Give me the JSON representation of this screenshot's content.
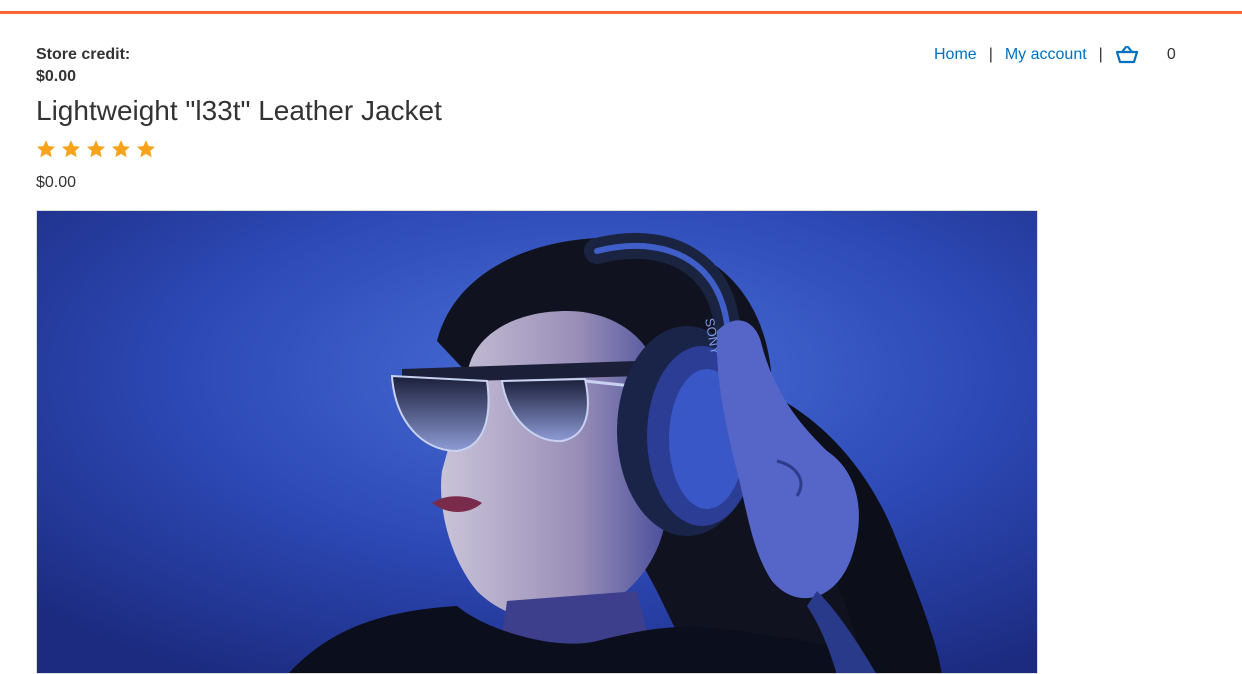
{
  "header": {
    "store_credit_label": "Store credit:",
    "store_credit_value": "$0.00",
    "nav": {
      "home": "Home",
      "separator": "|",
      "my_account": "My account",
      "cart_count": "0"
    },
    "accent_color": "#ff6633",
    "link_color": "#0071c1"
  },
  "product": {
    "title": "Lightweight \"l33t\" Leather Jacket",
    "rating_stars": 5,
    "rating_max": 5,
    "star_color": "#f7a21b",
    "price": "$0.00",
    "image": {
      "icon": "product-photo",
      "headphone_brand_text": "SONY"
    }
  }
}
